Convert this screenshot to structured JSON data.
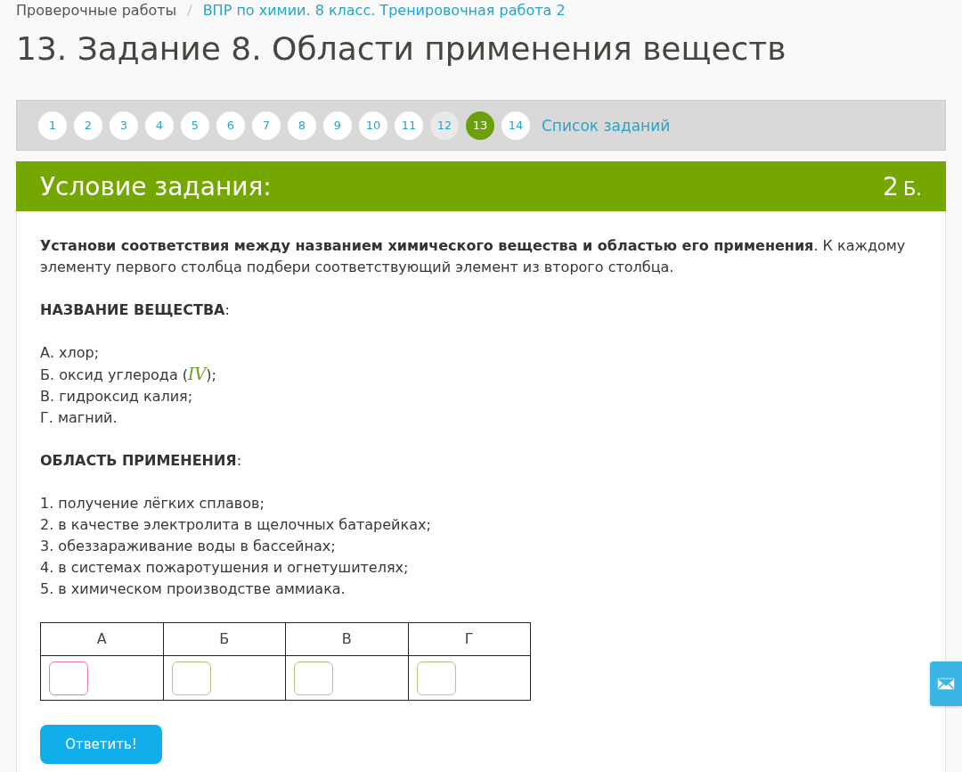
{
  "breadcrumb": {
    "items": [
      {
        "label": "Проверочные работы",
        "link": false
      },
      {
        "label": "ВПР по химии. 8 класс. Тренировочная работа 2",
        "link": true
      }
    ],
    "separator": "/"
  },
  "title": "13. Задание 8. Области применения веществ",
  "task_nav": {
    "items": [
      {
        "label": "1",
        "selected": false,
        "visited": false
      },
      {
        "label": "2",
        "selected": false,
        "visited": false
      },
      {
        "label": "3",
        "selected": false,
        "visited": false
      },
      {
        "label": "4",
        "selected": false,
        "visited": false
      },
      {
        "label": "5",
        "selected": false,
        "visited": false
      },
      {
        "label": "6",
        "selected": false,
        "visited": false
      },
      {
        "label": "7",
        "selected": false,
        "visited": false
      },
      {
        "label": "8",
        "selected": false,
        "visited": false
      },
      {
        "label": "9",
        "selected": false,
        "visited": false
      },
      {
        "label": "10",
        "selected": false,
        "visited": false
      },
      {
        "label": "11",
        "selected": false,
        "visited": false
      },
      {
        "label": "12",
        "selected": false,
        "visited": true
      },
      {
        "label": "13",
        "selected": true,
        "visited": false
      },
      {
        "label": "14",
        "selected": false,
        "visited": false
      }
    ],
    "list_link": "Список заданий"
  },
  "task": {
    "heading": "Условие задания:",
    "points": "2",
    "points_unit": "Б.",
    "intro": "**Установи соответствия между названием химического вещества и областью его применения**. К каждому элементу первого столбца подбери соответствующий элемент из второго столбца.",
    "sections": [
      {
        "heading": "**НАЗВАНИЕ ВЕЩЕСТВА**:",
        "items": [
          "А. хлор;",
          "Б. оксид углерода (*IV*);",
          "В. гидроксид калия;",
          "Г. магний."
        ]
      },
      {
        "heading": "**ОБЛАСТЬ ПРИМЕНЕНИЯ**:",
        "items": [
          "1. получение лёгких сплавов;",
          "2. в качестве электролита в щелочных батарейках;",
          "3. обеззараживание воды в бассейнах;",
          "4. в системах пожаротушения и огнетушителях;",
          "5. в химическом производстве аммиака."
        ]
      }
    ],
    "answer_table": {
      "columns": [
        "А",
        "Б",
        "В",
        "Г"
      ],
      "fields": [
        {
          "active": true
        },
        {
          "active": false
        },
        {
          "active": false
        },
        {
          "active": false
        }
      ]
    },
    "submit_button": "Ответить!"
  }
}
